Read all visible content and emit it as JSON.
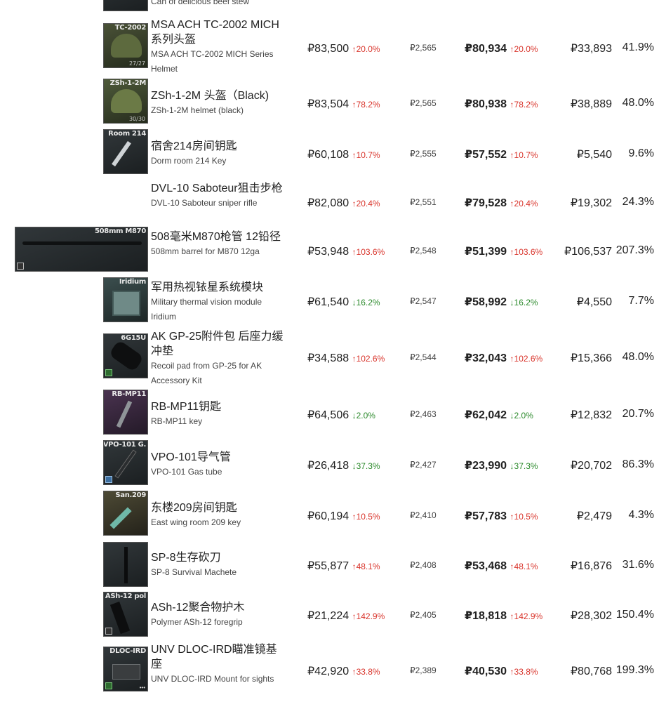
{
  "colors": {
    "up": "#d9342b",
    "down": "#2c8a2c"
  },
  "top_partial": {
    "sub": "Can of delicious beef stew"
  },
  "rows": [
    {
      "tag": "TC-2002",
      "count": "27/27",
      "name": "MSA ACH TC-2002 MICH系列头盔",
      "sub": "MSA ACH TC-2002 MICH Series Helmet",
      "price": "₽83,500",
      "price_change": "↑20.0%",
      "fee": "₽2,565",
      "sell": "₽80,934",
      "sell_change": "↑20.0%",
      "profit": "₽33,893",
      "ratio": "41.9%",
      "dir": "up",
      "icon": "helmet-icon"
    },
    {
      "tag": "ZSh-1-2M",
      "count": "30/30",
      "name": "ZSh-1-2M 头盔（Black)",
      "sub": "ZSh-1-2M helmet (black)",
      "price": "₽83,504",
      "price_change": "↑78.2%",
      "fee": "₽2,565",
      "sell": "₽80,938",
      "sell_change": "↑78.2%",
      "profit": "₽38,889",
      "ratio": "48.0%",
      "dir": "up",
      "icon": "helmet-icon"
    },
    {
      "tag": "Room 214",
      "name": "宿舍214房间钥匙",
      "sub": "Dorm room 214 Key",
      "price": "₽60,108",
      "price_change": "↑10.7%",
      "fee": "₽2,555",
      "sell": "₽57,552",
      "sell_change": "↑10.7%",
      "profit": "₽5,540",
      "ratio": "9.6%",
      "dir": "up",
      "icon": "key-icon"
    },
    {
      "tag": "",
      "name": "DVL-10 Saboteur狙击步枪",
      "sub": "DVL-10 Saboteur sniper rifle",
      "price": "₽82,080",
      "price_change": "↑20.4%",
      "fee": "₽2,551",
      "sell": "₽79,528",
      "sell_change": "↑20.4%",
      "profit": "₽19,302",
      "ratio": "24.3%",
      "dir": "up",
      "icon": "rifle-icon"
    },
    {
      "tag": "508mm M870",
      "name": "508毫米M870枪管 12铅径",
      "sub": "508mm barrel for M870 12ga",
      "price": "₽53,948",
      "price_change": "↑103.6%",
      "fee": "₽2,548",
      "sell": "₽51,399",
      "sell_change": "↑103.6%",
      "profit": "₽106,537",
      "ratio": "207.3%",
      "dir": "up",
      "icon": "barrel-icon"
    },
    {
      "tag": "Iridium",
      "name": "军用热视铱星系统模块",
      "sub": "Military thermal vision module Iridium",
      "price": "₽61,540",
      "price_change": "↓16.2%",
      "fee": "₽2,547",
      "sell": "₽58,992",
      "sell_change": "↓16.2%",
      "profit": "₽4,550",
      "ratio": "7.7%",
      "dir": "down",
      "icon": "module-icon"
    },
    {
      "tag": "6G15U",
      "name": "AK GP-25附件包 后座力缓冲垫",
      "sub": "Recoil pad from GP-25 for AK Accessory Kit",
      "price": "₽34,588",
      "price_change": "↑102.6%",
      "fee": "₽2,544",
      "sell": "₽32,043",
      "sell_change": "↑102.6%",
      "profit": "₽15,366",
      "ratio": "48.0%",
      "dir": "up",
      "icon": "recoil-pad-icon"
    },
    {
      "tag": "RB-MP11",
      "name": "RB-MP11钥匙",
      "sub": "RB-MP11 key",
      "price": "₽64,506",
      "price_change": "↓2.0%",
      "fee": "₽2,463",
      "sell": "₽62,042",
      "sell_change": "↓2.0%",
      "profit": "₽12,832",
      "ratio": "20.7%",
      "dir": "down",
      "icon": "key-icon"
    },
    {
      "tag": "VPO-101 G.",
      "name": "VPO-101导气管",
      "sub": "VPO-101 Gas tube",
      "price": "₽26,418",
      "price_change": "↓37.3%",
      "fee": "₽2,427",
      "sell": "₽23,990",
      "sell_change": "↓37.3%",
      "profit": "₽20,702",
      "ratio": "86.3%",
      "dir": "down",
      "icon": "gas-tube-icon"
    },
    {
      "tag": "San.209",
      "name": "东楼209房间钥匙",
      "sub": "East wing room 209 key",
      "price": "₽60,194",
      "price_change": "↑10.5%",
      "fee": "₽2,410",
      "sell": "₽57,783",
      "sell_change": "↑10.5%",
      "profit": "₽2,479",
      "ratio": "4.3%",
      "dir": "up",
      "icon": "key-icon"
    },
    {
      "tag": "",
      "name": "SP-8生存砍刀",
      "sub": "SP-8 Survival Machete",
      "price": "₽55,877",
      "price_change": "↑48.1%",
      "fee": "₽2,408",
      "sell": "₽53,468",
      "sell_change": "↑48.1%",
      "profit": "₽16,876",
      "ratio": "31.6%",
      "dir": "up",
      "icon": "machete-icon"
    },
    {
      "tag": "ASh-12 pol",
      "name": "ASh-12聚合物护木",
      "sub": "Polymer ASh-12 foregrip",
      "price": "₽21,224",
      "price_change": "↑142.9%",
      "fee": "₽2,405",
      "sell": "₽18,818",
      "sell_change": "↑142.9%",
      "profit": "₽28,302",
      "ratio": "150.4%",
      "dir": "up",
      "icon": "foregrip-icon"
    },
    {
      "tag": "DLOC-IRD",
      "name": "UNV DLOC-IRD瞄准镜基座",
      "sub": "UNV DLOC-IRD Mount for sights",
      "price": "₽42,920",
      "price_change": "↑33.8%",
      "fee": "₽2,389",
      "sell": "₽40,530",
      "sell_change": "↑33.8%",
      "profit": "₽80,768",
      "ratio": "199.3%",
      "dir": "up",
      "icon": "mount-icon"
    }
  ]
}
